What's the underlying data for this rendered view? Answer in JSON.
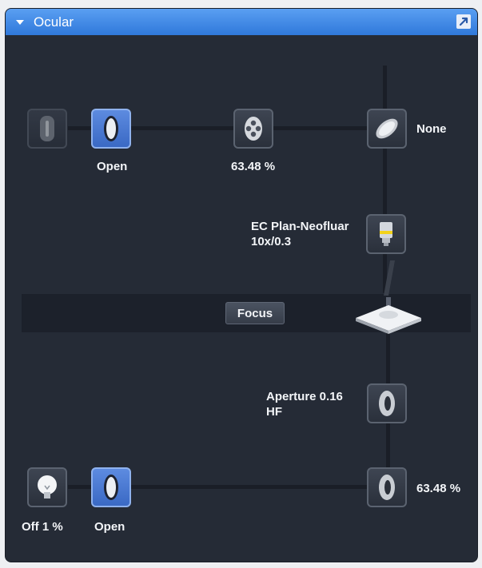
{
  "panel": {
    "title": "Ocular",
    "icons": {
      "collapse": "triangle-down-icon",
      "popout": "popout-arrow-icon"
    }
  },
  "top_path": {
    "filter_wheel": {
      "icon": "filter-slider-icon",
      "state": "inactive"
    },
    "shutter": {
      "icon": "lens-icon",
      "label": "Open",
      "state": "active"
    },
    "attenuator": {
      "icon": "filter-wheel-icon",
      "label": "63.48 %"
    },
    "mirror": {
      "icon": "mirror-icon",
      "label": "None"
    }
  },
  "objective": {
    "icon": "objective-icon",
    "label_line1": "EC Plan-Neofluar",
    "label_line2": "10x/0.3"
  },
  "focus": {
    "label": "Focus",
    "stage_icon": "stage-icon"
  },
  "aperture": {
    "icon": "aperture-icon",
    "label_line1": "Aperture 0.16",
    "label_line2": "HF"
  },
  "bottom_path": {
    "lamp": {
      "icon": "lamp-bulb-icon",
      "label": "Off 1 %"
    },
    "shutter": {
      "icon": "lens-icon",
      "label": "Open",
      "state": "active"
    },
    "field_stop": {
      "icon": "field-stop-icon",
      "label": "63.48 %"
    }
  },
  "colors": {
    "header": "#3b82e0",
    "panel_bg": "#252b36",
    "active_button": "#4a7ad4",
    "accent_yellow": "#f2d21c"
  }
}
